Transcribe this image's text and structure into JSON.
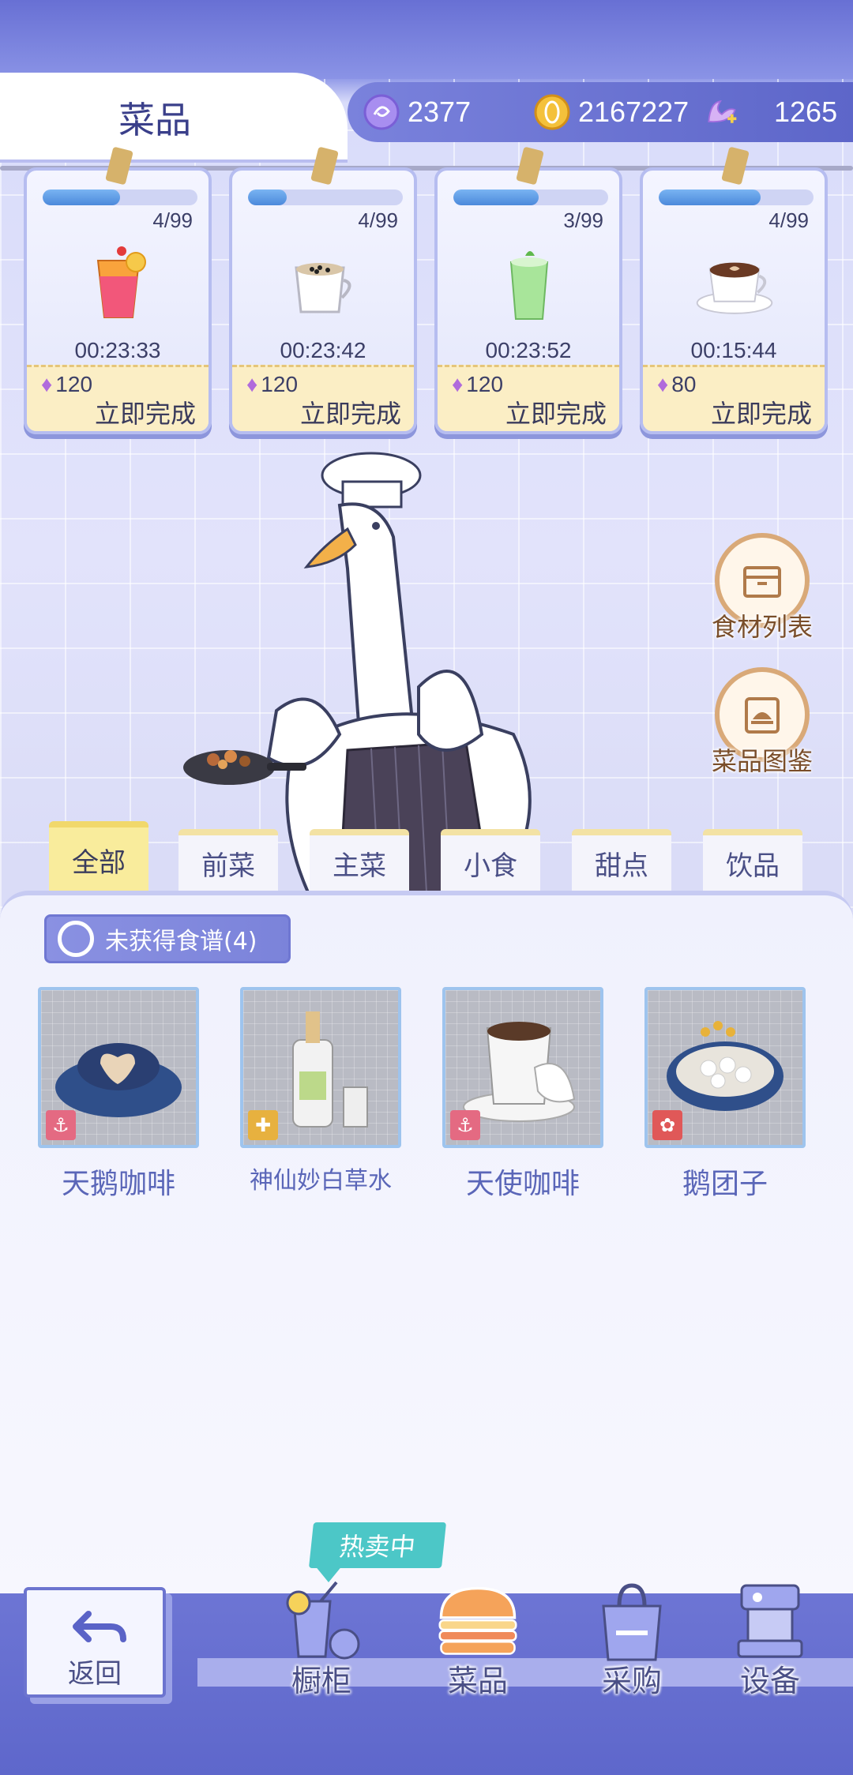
{
  "header": {
    "title": "菜品",
    "currencies": [
      {
        "icon": "purple-swirl-coin-icon",
        "value": "2377"
      },
      {
        "icon": "gold-coin-icon",
        "value": "2167227"
      },
      {
        "icon": "swan-gem-icon",
        "value": "1265"
      }
    ]
  },
  "cooking_slots": [
    {
      "icon": "orange-cocktail-icon",
      "count": "4/99",
      "progress": 0.5,
      "timer": "00:23:33",
      "cost": "120",
      "finish_label": "立即完成"
    },
    {
      "icon": "boba-milk-tea-icon",
      "count": "4/99",
      "progress": 0.25,
      "timer": "00:23:42",
      "cost": "120",
      "finish_label": "立即完成"
    },
    {
      "icon": "matcha-drink-icon",
      "count": "3/99",
      "progress": 0.55,
      "timer": "00:23:52",
      "cost": "120",
      "finish_label": "立即完成"
    },
    {
      "icon": "latte-art-cup-icon",
      "count": "4/99",
      "progress": 0.66,
      "timer": "00:15:44",
      "cost": "80",
      "finish_label": "立即完成"
    }
  ],
  "side_buttons": [
    {
      "icon": "box-icon",
      "label": "食材列表"
    },
    {
      "icon": "recipe-book-icon",
      "label": "菜品图鉴"
    }
  ],
  "tabs": [
    {
      "label": "全部",
      "active": true
    },
    {
      "label": "前菜",
      "active": false
    },
    {
      "label": "主菜",
      "active": false
    },
    {
      "label": "小食",
      "active": false
    },
    {
      "label": "甜点",
      "active": false
    },
    {
      "label": "饮品",
      "active": false
    }
  ],
  "filter_button": {
    "label": "未获得食谱(4)"
  },
  "recipes": [
    {
      "name": "天鹅咖啡",
      "tag_icon": "anchor-icon",
      "tag_color": "#e46a82"
    },
    {
      "name": "神仙妙白草水",
      "tag_icon": "puzzle-icon",
      "tag_color": "#e7b13f"
    },
    {
      "name": "天使咖啡",
      "tag_icon": "anchor-icon",
      "tag_color": "#e46a82"
    },
    {
      "name": "鹅团子",
      "tag_icon": "gift-icon",
      "tag_color": "#e05858"
    }
  ],
  "bottom_nav": {
    "back_label": "返回",
    "hot_badge": "热卖中",
    "items": [
      {
        "label": "橱柜",
        "icon": "drink-cabinet-icon"
      },
      {
        "label": "菜品",
        "icon": "burger-icon"
      },
      {
        "label": "采购",
        "icon": "shopping-bag-icon"
      },
      {
        "label": "设备",
        "icon": "coffee-machine-icon"
      }
    ]
  },
  "colors": {
    "accent": "#6d75d4",
    "tab_active": "#f9ec9c",
    "progress": "#4c89db",
    "recipe_name": "#5a66b8"
  }
}
